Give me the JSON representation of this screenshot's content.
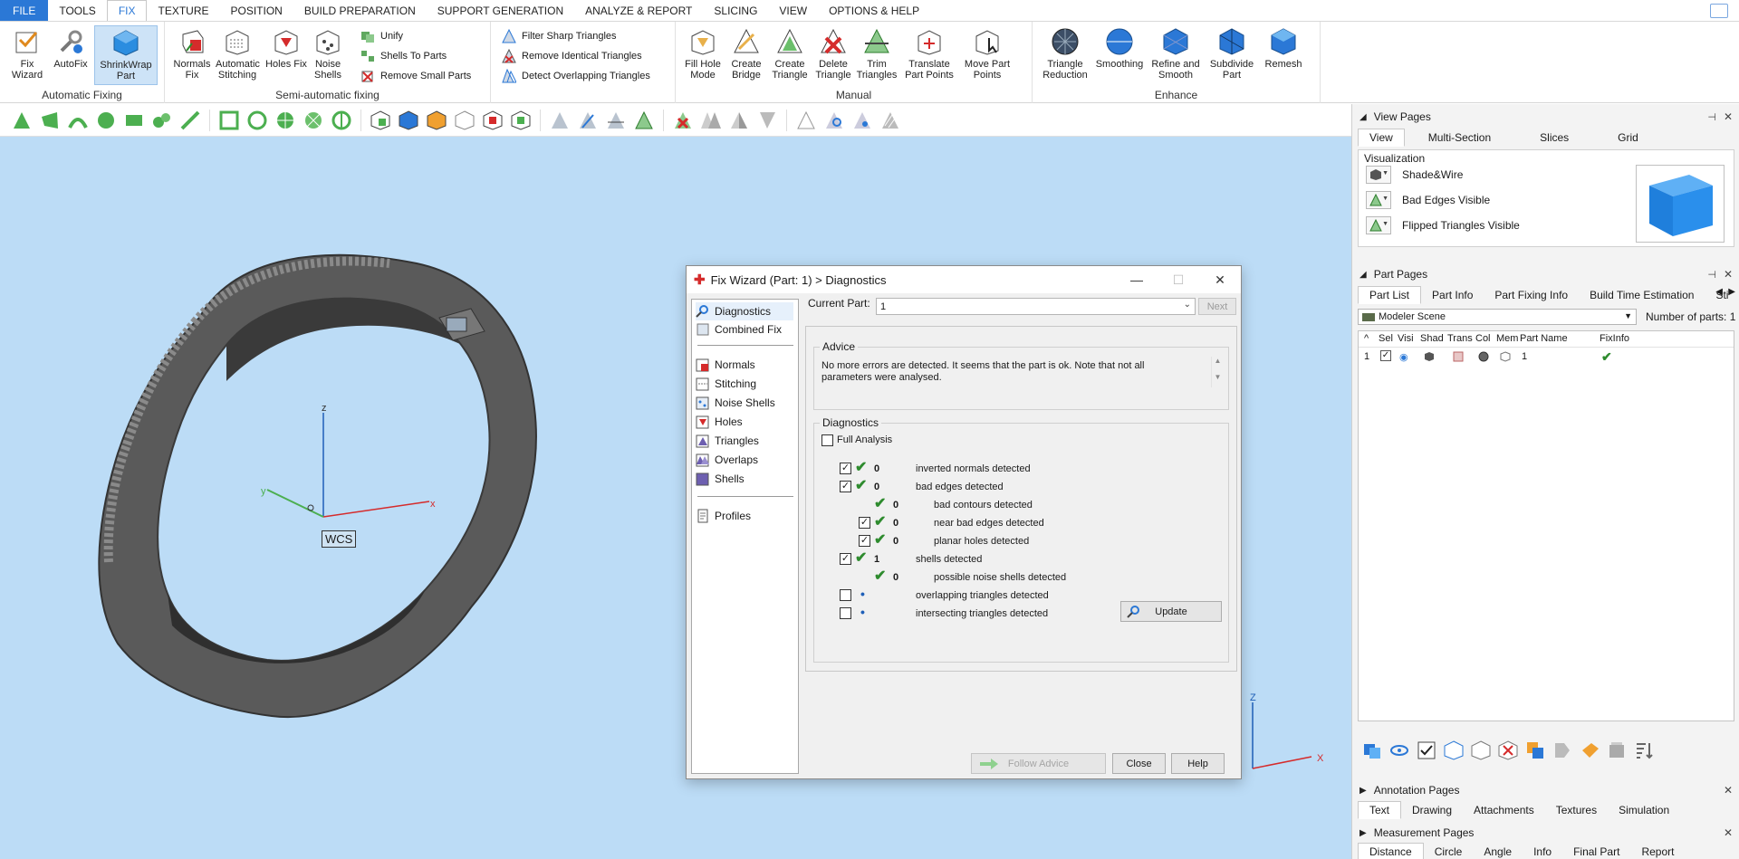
{
  "menu": {
    "items": [
      "FILE",
      "TOOLS",
      "FIX",
      "TEXTURE",
      "POSITION",
      "BUILD PREPARATION",
      "SUPPORT GENERATION",
      "ANALYZE & REPORT",
      "SLICING",
      "VIEW",
      "OPTIONS & HELP"
    ],
    "active": "FIX"
  },
  "ribbon": {
    "auto_group_label": "Automatic Fixing",
    "fix_wizard": "Fix Wizard",
    "autofix": "AutoFix",
    "shrinkwrap": "ShrinkWrap Part",
    "normals_fix": "Normals Fix",
    "auto_stitching": "Automatic Stitching",
    "holes_fix": "Holes Fix",
    "noise_shells": "Noise Shells",
    "semi_group_label": "Semi-automatic fixing",
    "unify": "Unify",
    "shells_to_parts": "Shells To Parts",
    "remove_small_parts": "Remove Small Parts",
    "filter_sharp": "Filter Sharp Triangles",
    "remove_identical": "Remove Identical Triangles",
    "detect_overlapping": "Detect Overlapping Triangles",
    "manual_group_label": "Manual",
    "fill_hole_mode": "Fill Hole Mode",
    "create_bridge": "Create Bridge",
    "create_triangle": "Create Triangle",
    "delete_triangle": "Delete Triangle",
    "trim_triangles": "Trim Triangles",
    "translate_points": "Translate Part Points",
    "move_points": "Move Part Points",
    "enhance_group_label": "Enhance",
    "triangle_reduction": "Triangle Reduction",
    "smoothing": "Smoothing",
    "refine_smooth": "Refine and Smooth",
    "subdivide": "Subdivide Part",
    "remesh": "Remesh"
  },
  "viewport": {
    "axis_x": "x",
    "axis_y": "y",
    "axis_z": "z",
    "wcs_label": "WCS",
    "corner_axis_x": "X",
    "corner_axis_z": "Z"
  },
  "dialog": {
    "title": "Fix Wizard (Part: 1) > Diagnostics",
    "nav": {
      "diagnostics": "Diagnostics",
      "combined_fix": "Combined Fix",
      "normals": "Normals",
      "stitching": "Stitching",
      "noise_shells": "Noise Shells",
      "holes": "Holes",
      "triangles": "Triangles",
      "overlaps": "Overlaps",
      "shells": "Shells",
      "profiles": "Profiles"
    },
    "current_part_label": "Current Part:",
    "current_part_value": "1",
    "next_button": "Next",
    "advice_legend": "Advice",
    "advice_text": "No more errors are detected. It seems that the part is ok. Note that not all parameters were analysed.",
    "diagnostics_legend": "Diagnostics",
    "full_analysis": "Full Analysis",
    "rows": [
      {
        "count": "0",
        "label": "inverted normals detected"
      },
      {
        "count": "0",
        "label": "bad edges detected"
      },
      {
        "count": "0",
        "label": "bad contours detected"
      },
      {
        "count": "0",
        "label": "near bad edges detected"
      },
      {
        "count": "0",
        "label": "planar holes detected"
      },
      {
        "count": "1",
        "label": "shells detected"
      },
      {
        "count": "0",
        "label": "possible noise shells detected"
      },
      {
        "count": "",
        "label": "overlapping triangles detected"
      },
      {
        "count": "",
        "label": "intersecting triangles detected"
      }
    ],
    "update_button": "Update",
    "follow_advice_button": "Follow Advice",
    "close_button": "Close",
    "help_button": "Help"
  },
  "right_panel": {
    "view_pages": {
      "header": "View Pages",
      "tabs": [
        "View",
        "Multi-Section",
        "Slices",
        "Grid"
      ],
      "visualization_label": "Visualization",
      "options": [
        "Shade&Wire",
        "Bad Edges Visible",
        "Flipped Triangles Visible"
      ]
    },
    "part_pages": {
      "header": "Part Pages",
      "tabs": [
        "Part List",
        "Part Info",
        "Part Fixing Info",
        "Build Time Estimation",
        "Sti"
      ],
      "scene": "Modeler Scene",
      "num_parts_label": "Number of parts:",
      "num_parts_value": "1",
      "columns": [
        "Sel",
        "Visi",
        "Shad",
        "Trans",
        "Col",
        "Mem",
        "Part Name",
        "FixInfo"
      ],
      "row": {
        "index": "1",
        "name": "1"
      }
    },
    "annotation_pages": {
      "header": "Annotation Pages",
      "tabs": [
        "Text",
        "Drawing",
        "Attachments",
        "Textures",
        "Simulation"
      ]
    },
    "measurement_pages": {
      "header": "Measurement Pages",
      "tabs": [
        "Distance",
        "Circle",
        "Angle",
        "Info",
        "Final Part",
        "Report"
      ]
    }
  },
  "colors": {
    "accent": "#2b78d6",
    "viewport_bg": "#bcdcf6",
    "check_green": "#2e8b2e",
    "error_red": "#d52b2b"
  }
}
